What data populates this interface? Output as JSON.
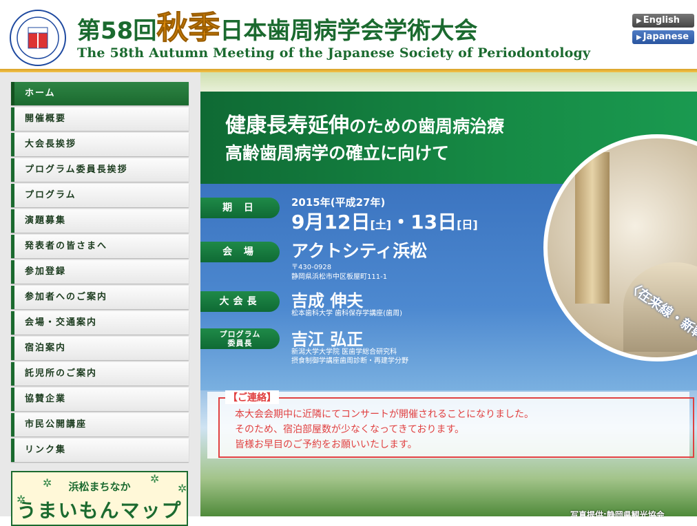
{
  "header": {
    "logo_text": "日本歯周病学会 1930",
    "title_jp_pre": "第58回",
    "title_jp_accent": "秋季",
    "title_jp_post": "日本歯周病学会学術大会",
    "title_en": "The 58th Autumn Meeting of the Japanese Society of Periodontology",
    "lang_english": "English",
    "lang_japanese": "Japanese"
  },
  "nav": {
    "items": [
      {
        "label": "ホーム",
        "active": true
      },
      {
        "label": "開催概要"
      },
      {
        "label": "大会長挨拶"
      },
      {
        "label": "プログラム委員長挨拶"
      },
      {
        "label": "プログラム"
      },
      {
        "label": "演題募集"
      },
      {
        "label": "発表者の皆さまへ"
      },
      {
        "label": "参加登録"
      },
      {
        "label": "参加者へのご案内"
      },
      {
        "label": "会場・交通案内"
      },
      {
        "label": "宿泊案内"
      },
      {
        "label": "託児所のご案内"
      },
      {
        "label": "協賛企業"
      },
      {
        "label": "市民公開講座"
      },
      {
        "label": "リンク集"
      }
    ]
  },
  "banner": {
    "sub": "浜松まちなか",
    "main": "うまいもんマップ"
  },
  "hero": {
    "theme_big": "健康長寿延伸",
    "theme_rest": "のための歯周病治療",
    "theme_line2": "高齢歯周病学の確立に向けて",
    "label_date": "期 日",
    "date_line1": "2015年(平成27年)",
    "date_day1": "9月12日",
    "date_dow1": "[土]",
    "date_sep": "・",
    "date_day2": "13日",
    "date_dow2": "[日]",
    "label_venue": "会 場",
    "venue_name": "アクトシティ浜松",
    "venue_zip": "〒430-0928",
    "venue_address": "静岡県浜松市中区板屋町111-1",
    "label_president": "大会長",
    "president_name": "吉成 伸夫",
    "president_affil": "松本歯科大学 歯科保存学講座(歯周)",
    "label_program_1": "プログラム",
    "label_program_2": "委員長",
    "program_name": "吉江 弘正",
    "program_affil_1": "新潟大学大学院 医歯学総合研究科",
    "program_affil_2": "摂食制御学講座歯周診断・再建学分野",
    "station_text": "〈在来線・新幹線ともJR浜松駅直結〉"
  },
  "notice": {
    "title": "【ご連絡】",
    "line1": "本大会会期中に近隣にてコンサートが開催されることになりました。",
    "line2": "そのため、宿泊部屋数が少なくなってきております。",
    "line3": "皆様お早目のご予約をお願いいたします。"
  },
  "credit": "写真提供:静岡県観光協会"
}
